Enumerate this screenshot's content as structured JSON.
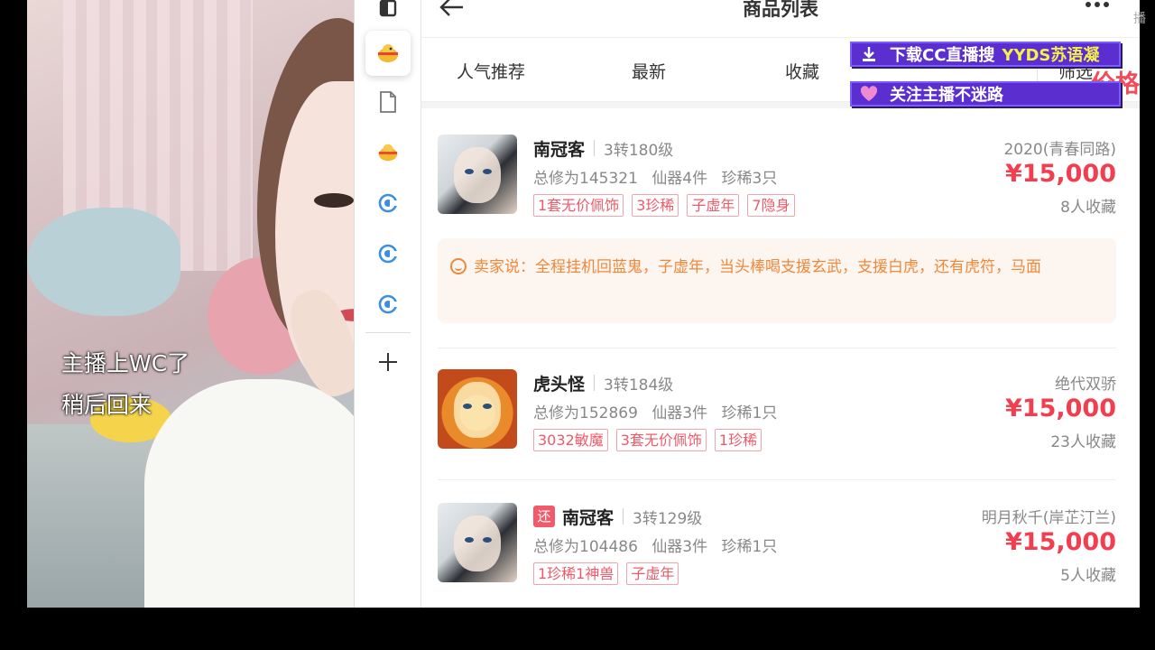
{
  "stream": {
    "caption_line1": "主播上WC了",
    "caption_line2": "稍后回来"
  },
  "toolbar": {
    "items": [
      {
        "icon": "window-icon"
      },
      {
        "icon": "game-chick-icon",
        "active": true
      },
      {
        "icon": "document-icon"
      },
      {
        "icon": "game-chick-icon"
      },
      {
        "icon": "refresh-c-icon"
      },
      {
        "icon": "refresh-c-icon"
      },
      {
        "icon": "refresh-c-icon"
      },
      {
        "icon": "plus-icon"
      }
    ]
  },
  "header": {
    "title": "商品列表",
    "back_icon": "arrow-left-icon",
    "more_icon": "more-dots-icon"
  },
  "tabs": [
    {
      "label": "人气推荐"
    },
    {
      "label": "最新"
    },
    {
      "label": "收藏"
    },
    {
      "label": "价格"
    },
    {
      "label": "筛选"
    }
  ],
  "items": [
    {
      "badge": "",
      "name": "南冠客",
      "level": "3转180级",
      "stats": [
        "总修为145321",
        "仙器4件",
        "珍稀3只"
      ],
      "tags": [
        "1套无价佩饰",
        "3珍稀",
        "子虚年",
        "7隐身"
      ],
      "server": "2020(青春同路)",
      "price": "¥15,000",
      "favorites": "8人收藏",
      "seller_note": "卖家说：全程挂机回蓝鬼，子虚年，当头棒喝支援玄武，支援白虎，还有虎符，马面"
    },
    {
      "badge": "",
      "name": "虎头怪",
      "level": "3转184级",
      "stats": [
        "总修为152869",
        "仙器3件",
        "珍稀1只"
      ],
      "tags": [
        "3032敏魔",
        "3套无价佩饰",
        "1珍稀"
      ],
      "server": "绝代双骄",
      "price": "¥15,000",
      "favorites": "23人收藏"
    },
    {
      "badge": "还",
      "name": "南冠客",
      "level": "3转129级",
      "stats": [
        "总修为104486",
        "仙器3件",
        "珍稀1只"
      ],
      "tags": [
        "1珍稀1神兽",
        "子虚年"
      ],
      "server": "明月秋千(岸芷汀兰)",
      "price": "¥15,000",
      "favorites": "5人收藏"
    }
  ],
  "overlay": {
    "banner1_text": "下载CC直播搜",
    "banner1_highlight": "YYDS苏语凝",
    "banner1_icon": "download-icon",
    "banner2_text": "关注主播不迷路",
    "banner2_icon": "heart-icon",
    "accent_color": "#5a2ecf",
    "edge_text": "播"
  },
  "colors": {
    "price": "#f23e4e",
    "tag": "#ef5a69",
    "seller_note": "#f0883a"
  }
}
